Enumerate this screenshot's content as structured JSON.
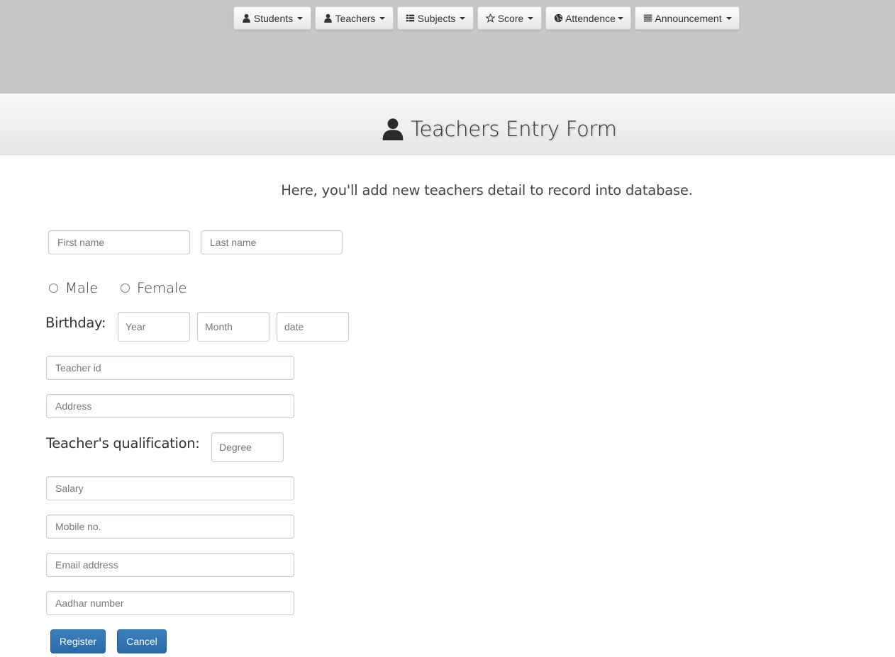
{
  "nav": {
    "students": "Students",
    "teachers": "Teachers",
    "subjects": "Subjects",
    "score": "Score",
    "attendence": "Attendence",
    "announcement": "Announcement"
  },
  "header": {
    "title": "Teachers Entry Form",
    "subtitle": "Here, you'll add new teachers detail to record into database."
  },
  "form": {
    "first_name_placeholder": "First name",
    "last_name_placeholder": "Last name",
    "gender_male": "Male",
    "gender_female": "Female",
    "birthday_label": "Birthday:",
    "year_placeholder": "Year",
    "month_placeholder": "Month",
    "date_placeholder": "date",
    "teacher_id_placeholder": "Teacher id",
    "address_placeholder": "Address",
    "qualification_label": "Teacher's qualification:",
    "degree_placeholder": "Degree",
    "salary_placeholder": "Salary",
    "mobile_placeholder": "Mobile no.",
    "email_placeholder": "Email address",
    "aadhar_placeholder": "Aadhar number",
    "register_label": "Register",
    "cancel_label": "Cancel"
  },
  "colors": {
    "topbar": "#c6c6c6",
    "primary_button": "#337ab7"
  }
}
